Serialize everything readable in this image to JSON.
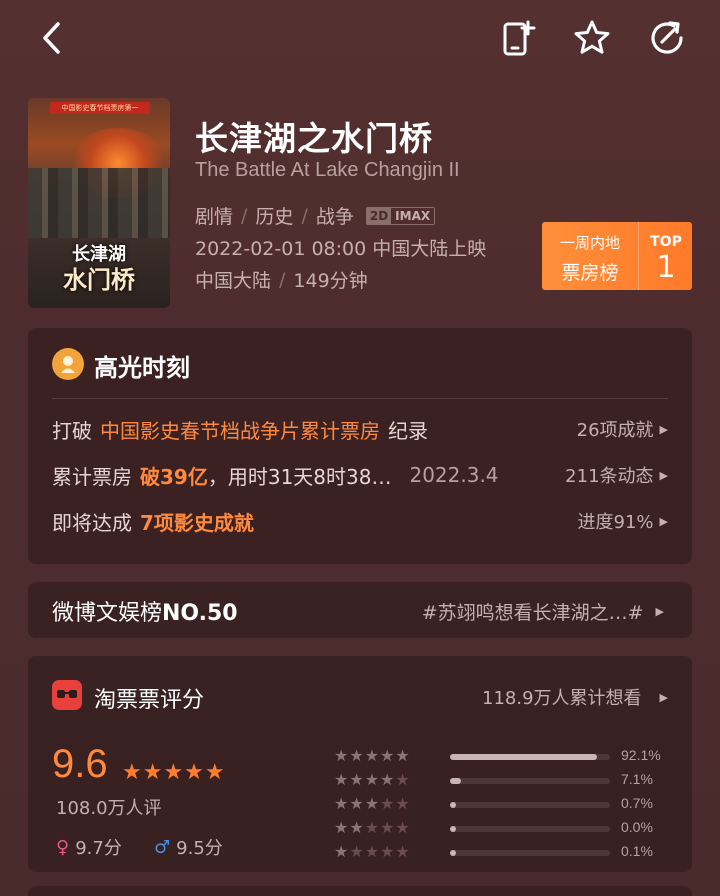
{
  "topbar": {
    "back_icon": "chevron-left-icon",
    "add_icon": "phone-add-icon",
    "star_icon": "star-outline-icon",
    "share_icon": "share-arrow-icon"
  },
  "movie": {
    "title": "长津湖之水门桥",
    "english_title": "The Battle At Lake Changjin II",
    "genres": [
      "剧情",
      "历史",
      "战争"
    ],
    "format_2d": "2D",
    "format_imax": "IMAX",
    "release": "2022-02-01 08:00 中国大陆上映",
    "region": "中国大陆",
    "duration": "149分钟",
    "poster": {
      "tag": "中国影史春节档票房第一",
      "title_line1": "长津湖",
      "title_line2": "水门桥"
    }
  },
  "rank_badge": {
    "line1": "一周内地",
    "line2": "票房榜",
    "top_label": "TOP",
    "top_value": "1"
  },
  "highlights": {
    "title": "高光时刻",
    "row1": {
      "prefix": "打破",
      "highlight": "中国影史春节档战争片累计票房",
      "suffix": "纪录",
      "right": "26项成就"
    },
    "row2": {
      "prefix": "累计票房",
      "highlight": "破39亿",
      "suffix": "，用时31天8时38…",
      "date": "2022.3.4",
      "right": "211条动态"
    },
    "row3": {
      "prefix": "即将达成",
      "highlight": "7项影史成就",
      "right": "进度91%"
    }
  },
  "weibo": {
    "title": "微博文娱榜",
    "rank": "NO.50",
    "tag": "#苏翊鸣想看长津湖之…#"
  },
  "rating": {
    "source": "淘票票评分",
    "want_count": "118.9万人累计想看",
    "score": "9.6",
    "stars_glyph": "★★★★★",
    "count": "108.0万人评",
    "female_score": "9.7分",
    "male_score": "9.5分",
    "distribution": [
      {
        "stars": 5,
        "percent": 92.1,
        "label": "92.1%"
      },
      {
        "stars": 4,
        "percent": 7.1,
        "label": "7.1%"
      },
      {
        "stars": 3,
        "percent": 0.7,
        "label": "0.7%"
      },
      {
        "stars": 2,
        "percent": 0.0,
        "label": "0.0%"
      },
      {
        "stars": 1,
        "percent": 0.1,
        "label": "0.1%"
      }
    ]
  },
  "colors": {
    "accent": "#ff8a3d",
    "background": "#4d2c2d",
    "badge": "#ff8432",
    "taopiaopiao": "#e8413b"
  }
}
